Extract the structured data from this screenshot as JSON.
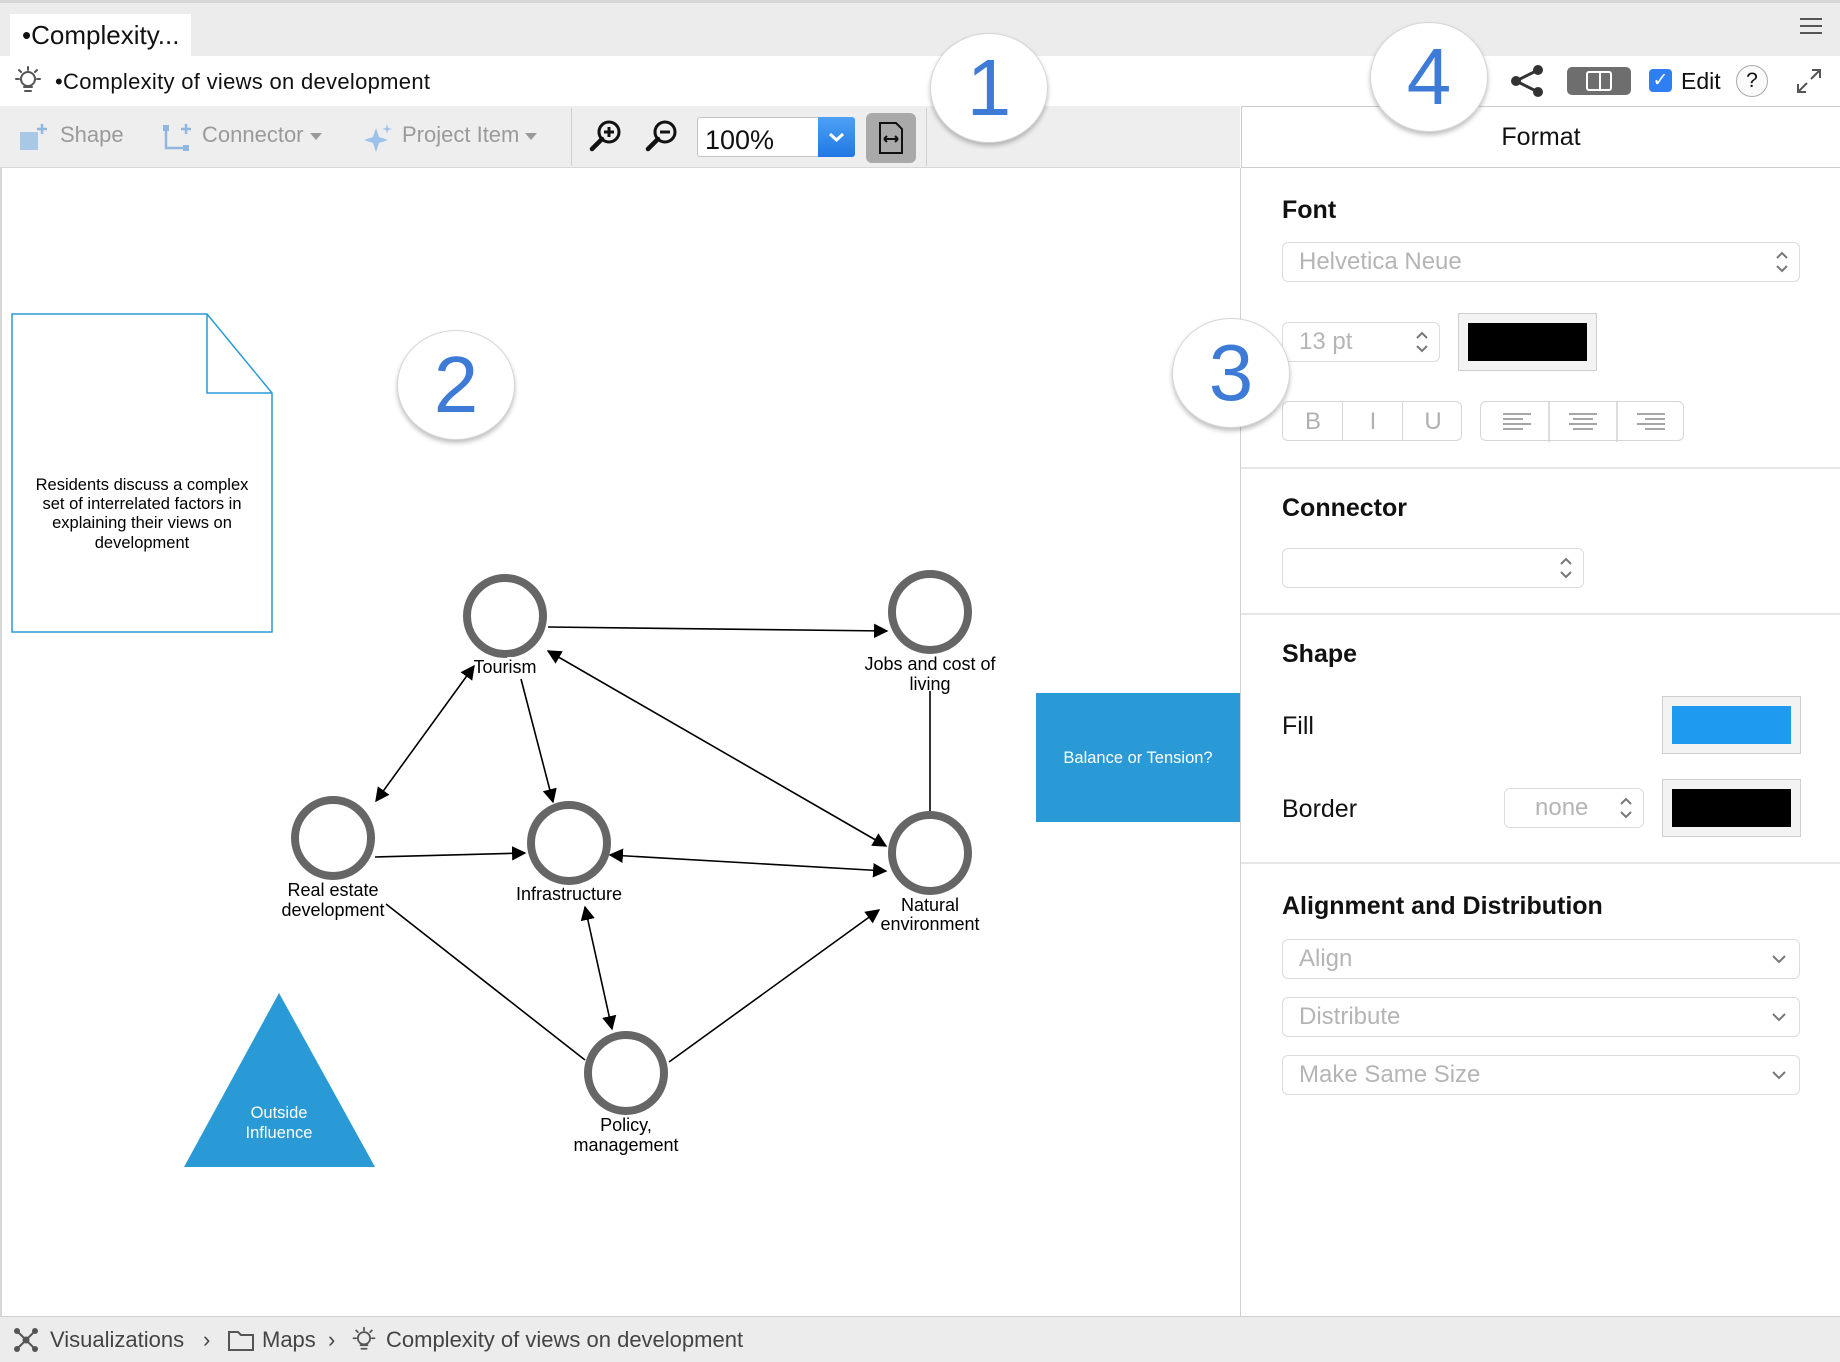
{
  "window": {
    "tab_title": "•Complexity...",
    "doc_title": "•Complexity of views on development"
  },
  "toolbar": {
    "shape_label": "Shape",
    "connector_label": "Connector",
    "project_item_label": "Project Item",
    "zoom_value": "100%"
  },
  "header_right": {
    "edit_label": "Edit",
    "edit_checked": true,
    "help_label": "?"
  },
  "panel": {
    "tab_label": "Format",
    "font": {
      "heading": "Font",
      "family_value": "Helvetica Neue",
      "size_value": "13 pt",
      "color": "#000000",
      "bold": "B",
      "italic": "I",
      "underline": "U"
    },
    "connector": {
      "heading": "Connector",
      "value": ""
    },
    "shape": {
      "heading": "Shape",
      "fill_label": "Fill",
      "fill_color": "#1e9af0",
      "border_label": "Border",
      "border_value": "none",
      "border_color": "#000000"
    },
    "alignment": {
      "heading": "Alignment and Distribution",
      "align": "Align",
      "distribute": "Distribute",
      "same_size": "Make Same Size"
    }
  },
  "diagram": {
    "note": "Residents discuss a complex set of interrelated factors in explaining their views on development",
    "nodes": [
      {
        "id": "tourism",
        "label": [
          "Tourism"
        ]
      },
      {
        "id": "jobs",
        "label": [
          "Jobs and cost of",
          "living"
        ]
      },
      {
        "id": "realestate",
        "label": [
          "Real estate",
          "development"
        ]
      },
      {
        "id": "infra",
        "label": [
          "Infrastructure"
        ]
      },
      {
        "id": "natural",
        "label": [
          "Natural",
          "environment"
        ]
      },
      {
        "id": "policy",
        "label": [
          "Policy,",
          "management"
        ]
      }
    ],
    "balance_box": "Balance or Tension?",
    "outside": [
      "Outside",
      "Influence"
    ],
    "colors": {
      "node_ring": "#666666",
      "accent_fill": "#2a9ad6",
      "note_border": "#2a9ad6"
    }
  },
  "callouts": [
    "1",
    "2",
    "3",
    "4"
  ],
  "breadcrumb": {
    "item1": "Visualizations",
    "item2": "Maps",
    "item3": "Complexity of views on development",
    "separator": "›"
  }
}
